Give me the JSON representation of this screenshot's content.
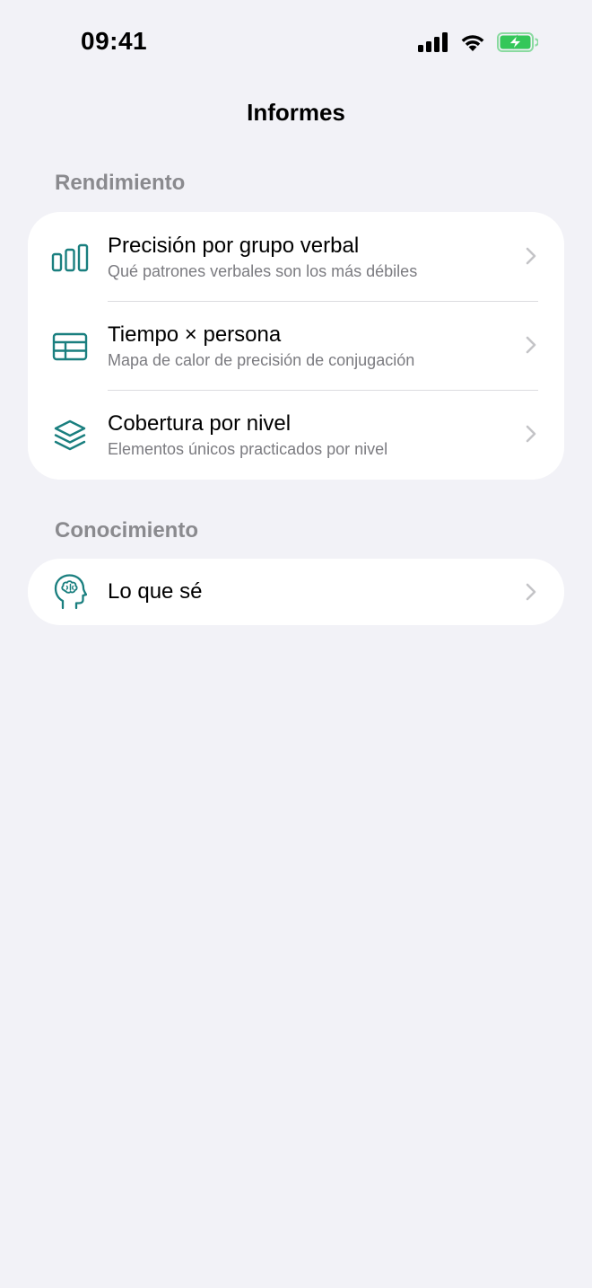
{
  "status_bar": {
    "time": "09:41",
    "icons": [
      "cellular-signal-icon",
      "wifi-icon",
      "battery-charging-icon"
    ],
    "battery_color": "#34c759"
  },
  "nav": {
    "title": "Informes"
  },
  "accent_color": "#1a7f7f",
  "sections": [
    {
      "header": "Rendimiento",
      "items": [
        {
          "icon": "bar-chart-icon",
          "title": "Precisión por grupo verbal",
          "subtitle": "Qué patrones verbales son los más débiles"
        },
        {
          "icon": "table-grid-icon",
          "title": "Tiempo × persona",
          "subtitle": "Mapa de calor de precisión de conjugación"
        },
        {
          "icon": "layers-icon",
          "title": "Cobertura por nivel",
          "subtitle": "Elementos únicos practicados por nivel"
        }
      ]
    },
    {
      "header": "Conocimiento",
      "items": [
        {
          "icon": "brain-head-icon",
          "title": "Lo que sé"
        }
      ]
    }
  ]
}
